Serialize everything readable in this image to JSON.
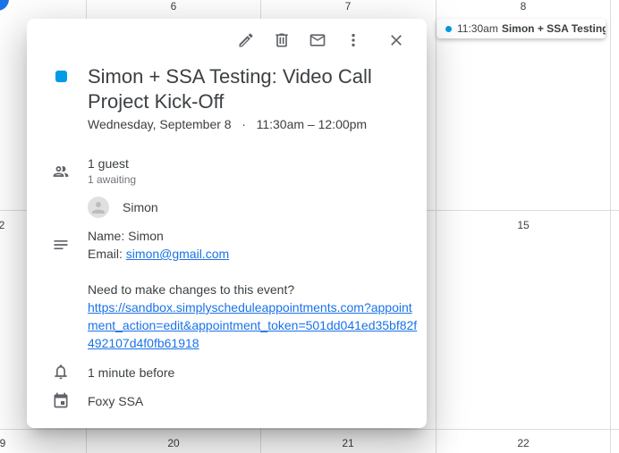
{
  "calendar": {
    "top_row_days": [
      "6",
      "7",
      "8"
    ],
    "middle_row_days": [
      "2",
      "15"
    ],
    "bottom_row_days": [
      "9",
      "20",
      "21",
      "22"
    ],
    "accent_color": "#1a73e8",
    "event_chip": {
      "time": "11:30am",
      "title": "Simon + SSA Testing",
      "color": "#039be5"
    }
  },
  "popup": {
    "toolbar": {
      "edit": "edit-icon",
      "delete": "delete-icon",
      "email": "email-icon",
      "more": "more-options-icon",
      "close": "close-icon"
    },
    "event_color": "#039be5",
    "title": "Simon + SSA Testing: Video Call Project Kick-Off",
    "date": "Wednesday, September 8",
    "separator": "·",
    "time": "11:30am – 12:00pm",
    "guests": {
      "count_label": "1 guest",
      "status_label": "1 awaiting",
      "list": [
        {
          "name": "Simon"
        }
      ]
    },
    "description": {
      "name_line": "Name: Simon",
      "email_prefix": "Email: ",
      "email": "simon@gmail.com",
      "changes_prompt": "Need to make changes to this event?",
      "edit_url": "https://sandbox.simplyscheduleappointments.com?appointment_action=edit&appointment_token=501dd041ed35bf82f492107d4f0fb61918"
    },
    "reminder": "1 minute before",
    "calendar_name": "Foxy SSA"
  }
}
